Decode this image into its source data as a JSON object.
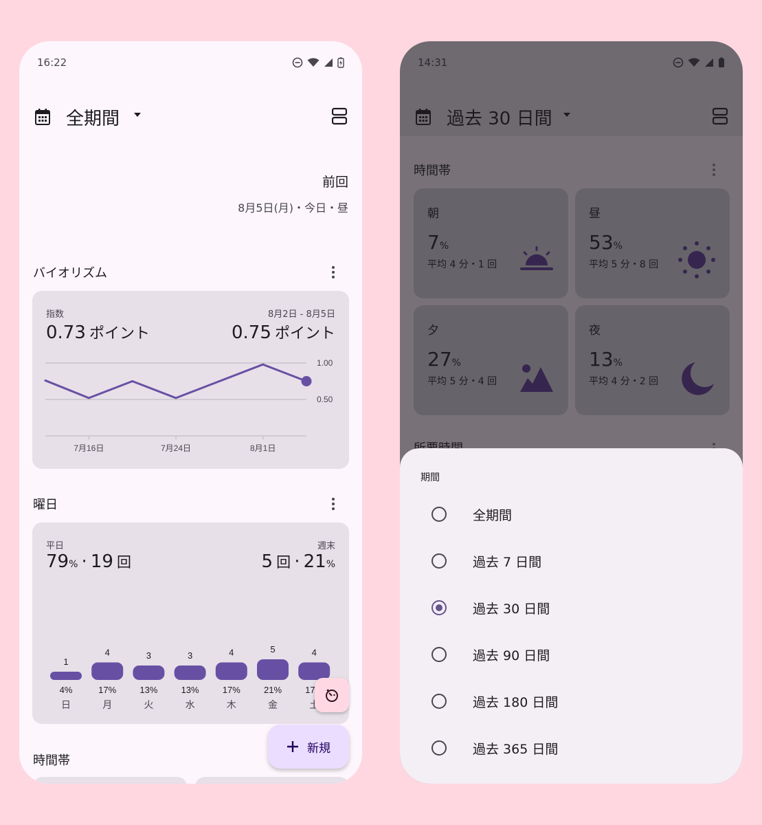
{
  "colors": {
    "accent": "#65558f",
    "chart_line": "#6750a4",
    "background": "#ffd7e0"
  },
  "left": {
    "status": {
      "time": "16:22"
    },
    "header": {
      "period": "全期間",
      "calendar_icon": "calendar-icon",
      "layout_icon": "view-agenda-icon"
    },
    "last": {
      "label": "前回",
      "value": "8月5日(月)・今日・昼"
    },
    "biorhythm": {
      "title": "バイオリズム",
      "index_label": "指数",
      "index_value": "0.73",
      "range_label": "8月2日 - 8月5日",
      "range_value": "0.75",
      "unit": "ポイント"
    },
    "weekday": {
      "title": "曜日",
      "weekday_label": "平日",
      "weekday_pct": "79",
      "weekday_count": "19",
      "weekend_label": "週末",
      "weekend_count": "5",
      "weekend_pct": "21",
      "pct_unit": "%",
      "count_unit": "回",
      "sep": "·"
    },
    "timeofday_title": "時間帯",
    "fab": {
      "new_label": "新規"
    }
  },
  "chart_data": [
    {
      "type": "line",
      "x": [
        "7月12日",
        "7月16日",
        "7月20日",
        "7月24日",
        "7月28日",
        "8月1日",
        "8月5日"
      ],
      "xticks": [
        "7月16日",
        "7月24日",
        "8月1日"
      ],
      "values": [
        0.76,
        0.52,
        0.75,
        0.52,
        0.75,
        0.98,
        0.75
      ],
      "ylim": [
        0.0,
        1.0
      ],
      "yticks": [
        "1.00",
        "0.50"
      ]
    },
    {
      "type": "bar",
      "categories": [
        "日",
        "月",
        "火",
        "水",
        "木",
        "金",
        "土"
      ],
      "values": [
        1,
        4,
        3,
        3,
        4,
        5,
        4
      ],
      "percents": [
        "4%",
        "17%",
        "13%",
        "13%",
        "17%",
        "21%",
        "17%"
      ],
      "ylim": [
        0,
        5
      ]
    }
  ],
  "right": {
    "status": {
      "time": "14:31"
    },
    "header": {
      "period": "過去 30 日間"
    },
    "timeofday": {
      "title": "時間帯",
      "cards": [
        {
          "name": "朝",
          "pct": "7",
          "sub": "平均 4 分・1 回",
          "icon": "sunrise-icon"
        },
        {
          "name": "昼",
          "pct": "53",
          "sub": "平均 5 分・8 回",
          "icon": "sun-icon"
        },
        {
          "name": "夕",
          "pct": "27",
          "sub": "平均 5 分・4 回",
          "icon": "landscape-icon"
        },
        {
          "name": "夜",
          "pct": "13",
          "sub": "平均 4 分・2 回",
          "icon": "moon-icon"
        }
      ]
    },
    "next_section": "所要時間",
    "sheet": {
      "title": "期間",
      "options": [
        "全期間",
        "過去 7 日間",
        "過去 30 日間",
        "過去 90 日間",
        "過去 180 日間",
        "過去 365 日間"
      ],
      "selected": "過去 30 日間"
    }
  }
}
